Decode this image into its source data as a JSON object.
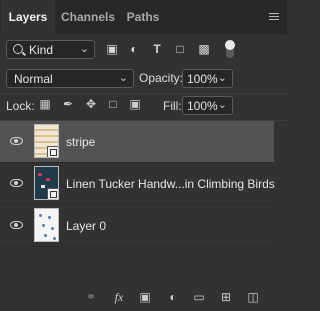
{
  "panel": {
    "tabs": [
      {
        "label": "Layers",
        "active": true
      },
      {
        "label": "Channels",
        "active": false
      },
      {
        "label": "Paths",
        "active": false
      }
    ]
  },
  "filter": {
    "kind_label": "Kind",
    "filter_icons": [
      "image-filter-icon",
      "adjustment-filter-icon",
      "type-filter-icon",
      "shape-filter-icon",
      "smart-object-filter-icon"
    ]
  },
  "blend": {
    "mode": "Normal",
    "opacity_label": "Opacity:",
    "opacity_value": "100%"
  },
  "lock": {
    "label": "Lock:",
    "fill_label": "Fill:",
    "fill_value": "100%"
  },
  "layers": [
    {
      "name": "stripe",
      "selected": true
    },
    {
      "name": "Linen Tucker Handw...in Climbing Birds",
      "selected": false
    },
    {
      "name": "Layer 0",
      "selected": false
    }
  ],
  "colors": {
    "panel_bg": "#323232",
    "tabbar_bg": "#282828",
    "selected_row": "#535353"
  }
}
